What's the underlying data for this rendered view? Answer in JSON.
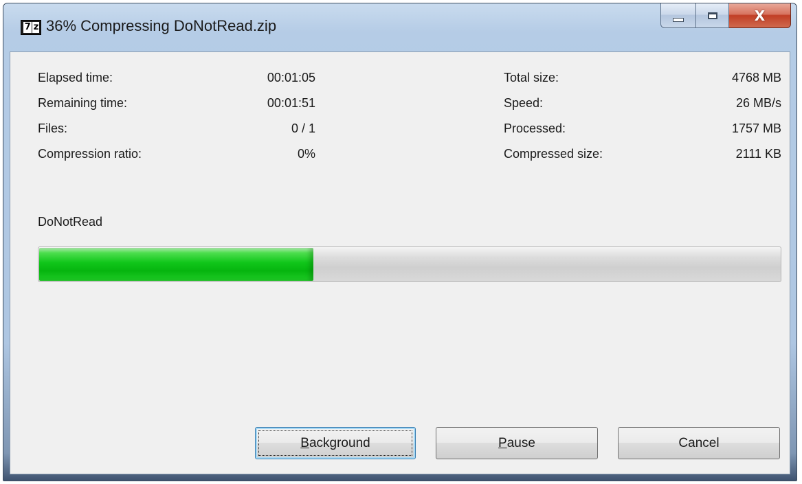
{
  "window": {
    "title": "36% Compressing DoNotRead.zip",
    "icon": "7z-app-icon",
    "icon_text_7": "7",
    "icon_text_z": "z"
  },
  "caption_buttons": {
    "minimize": "minimize-icon",
    "maximize": "maximize-icon",
    "close_glyph": "X"
  },
  "stats_left": [
    {
      "label": "Elapsed time:",
      "value": "00:01:05"
    },
    {
      "label": "Remaining time:",
      "value": "00:01:51"
    },
    {
      "label": "Files:",
      "value": "0 / 1"
    },
    {
      "label": "Compression ratio:",
      "value": "0%"
    }
  ],
  "stats_right": [
    {
      "label": "Total size:",
      "value": "4768 MB"
    },
    {
      "label": "Speed:",
      "value": "26 MB/s"
    },
    {
      "label": "Processed:",
      "value": "1757 MB"
    },
    {
      "label": "Compressed size:",
      "value": "2111 KB"
    }
  ],
  "current_file": "DoNotRead",
  "progress": {
    "fraction": 0.37,
    "color": "#10c61a"
  },
  "buttons": {
    "background": {
      "mnemonic": "B",
      "rest": "ackground"
    },
    "pause": {
      "mnemonic": "P",
      "rest": "ause"
    },
    "cancel": "Cancel"
  }
}
